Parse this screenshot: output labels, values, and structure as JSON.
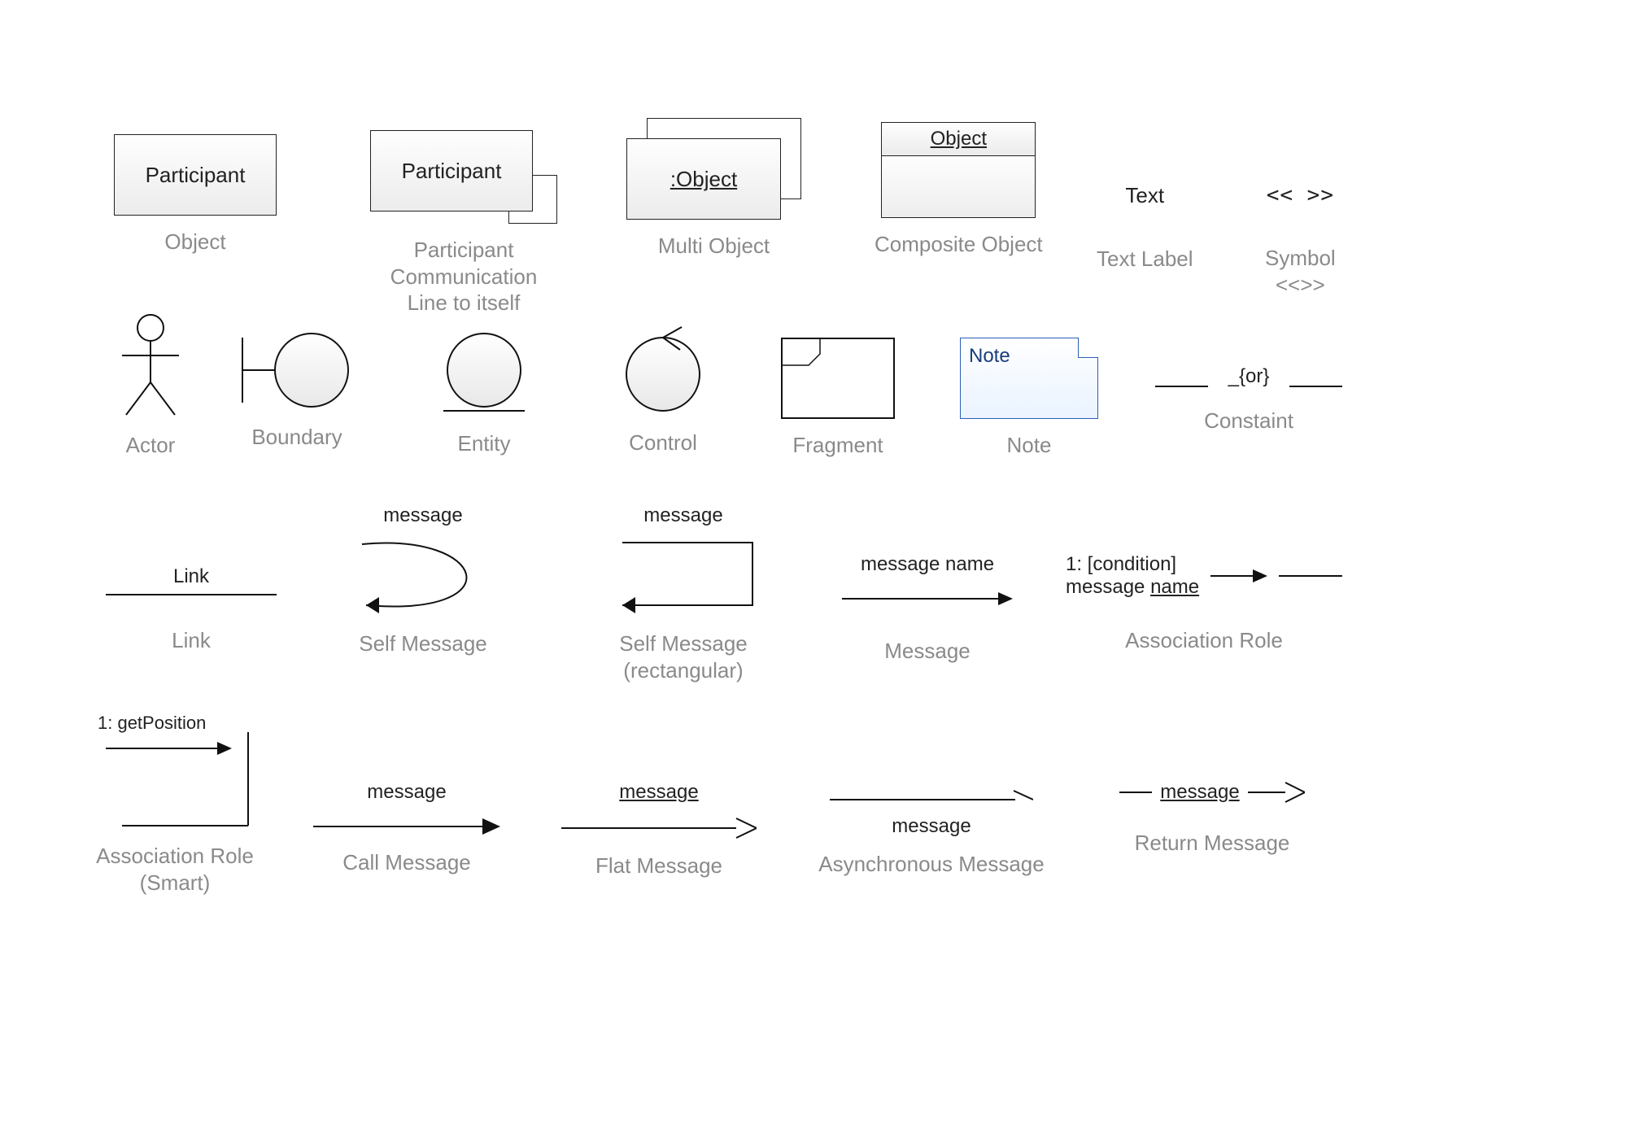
{
  "row1": {
    "object": {
      "label": "Participant",
      "caption": "Object"
    },
    "participant_self": {
      "label": "Participant",
      "caption": "Participant Communication\nLine to itself"
    },
    "multi_object": {
      "label": ":Object",
      "caption": "Multi Object"
    },
    "composite_object": {
      "label": "Object",
      "caption": "Composite Object"
    },
    "text_label": {
      "label": "Text",
      "caption": "Text Label"
    },
    "symbol": {
      "label": "<<  >>",
      "caption": "Symbol\n<<>>"
    }
  },
  "row2": {
    "actor": {
      "caption": "Actor"
    },
    "boundary": {
      "caption": "Boundary"
    },
    "entity": {
      "caption": "Entity"
    },
    "control": {
      "caption": "Control"
    },
    "fragment": {
      "caption": "Fragment"
    },
    "note": {
      "label": "Note",
      "caption": "Note"
    },
    "constraint": {
      "label": "_{or}",
      "caption": "Constaint"
    }
  },
  "row3": {
    "link": {
      "label": "Link",
      "caption": "Link"
    },
    "self_message": {
      "label": "message",
      "caption": "Self Message"
    },
    "self_message_rect": {
      "label": "message",
      "caption": "Self Message\n(rectangular)"
    },
    "message": {
      "label": "message name",
      "caption": "Message"
    },
    "assoc_role": {
      "label1": "1: [condition]",
      "label2": "message name",
      "caption": "Association Role"
    }
  },
  "row4": {
    "assoc_role_smart": {
      "label": "1: getPosition",
      "caption": "Association Role\n(Smart)"
    },
    "call_message": {
      "label": "message",
      "caption": "Call Message"
    },
    "flat_message": {
      "label": "message",
      "caption": "Flat Message"
    },
    "async_message": {
      "label": "message",
      "caption": "Asynchronous Message"
    },
    "return_message": {
      "label": "message",
      "caption": "Return Message"
    }
  }
}
